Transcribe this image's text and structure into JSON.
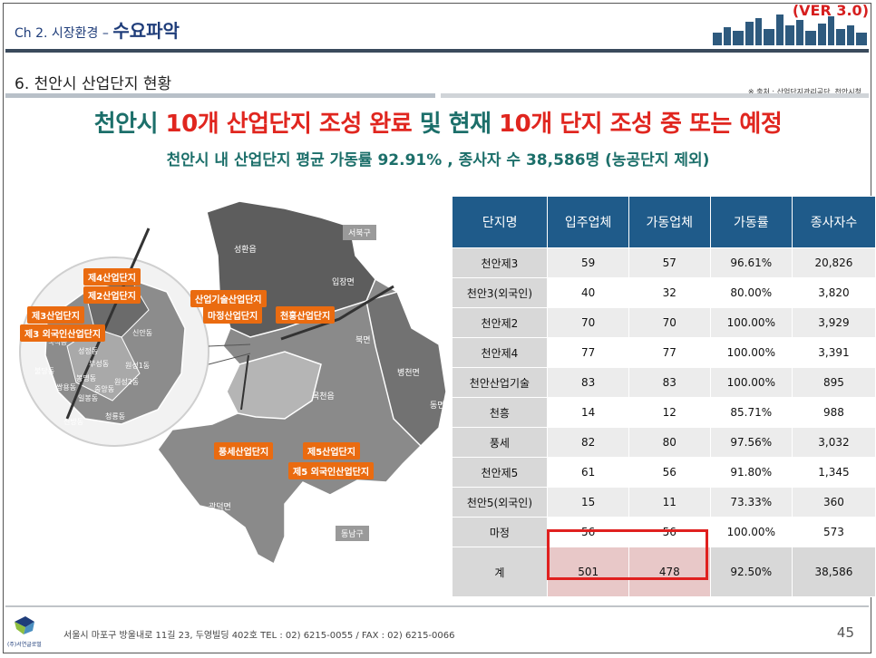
{
  "header": {
    "chapter_prefix": "Ch 2. 시장환경 –",
    "chapter_title": "수요파악",
    "version": "(VER 3.0)"
  },
  "section": {
    "title": "6. 천안시 산업단지 현황",
    "source": "※ 출처 : 산업단지관리공단, 천안시청"
  },
  "headline": {
    "part1": "천안시 ",
    "part2": "10개 산업단지 조성 완료",
    "part3": " 및 현재 ",
    "part4": "10개 단지 조성 중 또는 예정",
    "sub": "천안시 내 산업단지 평균 가동률 92.91% , 종사자 수 38,586명 (농공단지 제외)"
  },
  "map": {
    "districts": [
      "서북구",
      "성환읍",
      "입장면",
      "북면",
      "병천면",
      "동면",
      "목천읍",
      "광덕면",
      "동남구",
      "신안동",
      "원성1동",
      "원성2동",
      "봉명동",
      "쌍용동",
      "중앙동",
      "일봉동",
      "청룡동",
      "신방동",
      "불당동",
      "백석동",
      "성정동",
      "부성동"
    ],
    "tags": [
      "제4산업단지",
      "제2산업단지",
      "제3산업단지",
      "제3 외국인산업단지",
      "산업기술산업단지",
      "마정산업단지",
      "천흥산업단지",
      "풍세산업단지",
      "제5산업단지",
      "제5 외국인산업단지"
    ]
  },
  "table": {
    "headers": [
      "단지명",
      "입주업체",
      "가동업체",
      "가동률",
      "종사자수"
    ],
    "rows": [
      [
        "천안제3",
        "59",
        "57",
        "96.61%",
        "20,826"
      ],
      [
        "천안3(외국인)",
        "40",
        "32",
        "80.00%",
        "3,820"
      ],
      [
        "천안제2",
        "70",
        "70",
        "100.00%",
        "3,929"
      ],
      [
        "천안제4",
        "77",
        "77",
        "100.00%",
        "3,391"
      ],
      [
        "천안산업기술",
        "83",
        "83",
        "100.00%",
        "895"
      ],
      [
        "천흥",
        "14",
        "12",
        "85.71%",
        "988"
      ],
      [
        "풍세",
        "82",
        "80",
        "97.56%",
        "3,032"
      ],
      [
        "천안제5",
        "61",
        "56",
        "91.80%",
        "1,345"
      ],
      [
        "천안5(외국인)",
        "15",
        "11",
        "73.33%",
        "360"
      ],
      [
        "마정",
        "56",
        "56",
        "100.00%",
        "573"
      ]
    ],
    "total": [
      "계",
      "501",
      "478",
      "92.50%",
      "38,586"
    ]
  },
  "footer": {
    "address": "서울시 마포구 방울내로 11길 23, 두영빌딩 402호    TEL : 02) 6215-0055 / FAX : 02) 6215-0066",
    "page": "45",
    "logo_text": "(주)서연글로벌"
  },
  "colors": {
    "teal": "#1c6f6a",
    "red": "#e0261f",
    "navy": "#1f3d7a",
    "table_header": "#1f5b8a",
    "tag_orange": "#ea6b10"
  }
}
